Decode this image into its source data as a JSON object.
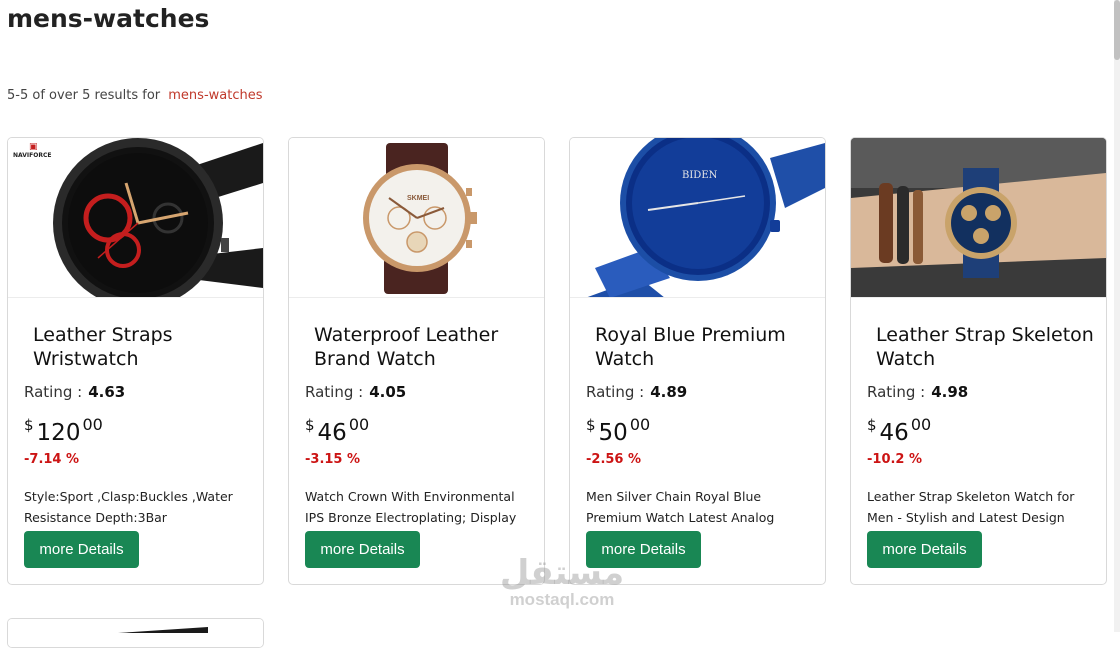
{
  "page": {
    "title": "mens-watches",
    "results_prefix": "5-5 of over 5 results for",
    "results_term": "mens-watches"
  },
  "labels": {
    "rating": "Rating :",
    "currency": "$",
    "more_details": "more Details"
  },
  "products": [
    {
      "name": "Leather Straps Wristwatch",
      "rating": "4.63",
      "price_whole": "120",
      "price_cents": "00",
      "discount": "-7.14 %",
      "description": "Style:Sport ,Clasp:Buckles ,Water Resistance Depth:3Bar",
      "image_brand": "NAVIFORCE"
    },
    {
      "name": "Waterproof Leather Brand Watch",
      "rating": "4.05",
      "price_whole": "46",
      "price_cents": "00",
      "discount": "-3.15 %",
      "description": "Watch Crown With Environmental IPS Bronze Electroplating; Display",
      "image_brand": "SKMEI"
    },
    {
      "name": "Royal Blue Premium Watch",
      "rating": "4.89",
      "price_whole": "50",
      "price_cents": "00",
      "discount": "-2.56 %",
      "description": "Men Silver Chain Royal Blue Premium Watch Latest Analog",
      "image_brand": "BIDEN"
    },
    {
      "name": "Leather Strap Skeleton Watch",
      "rating": "4.98",
      "price_whole": "46",
      "price_cents": "00",
      "discount": "-10.2 %",
      "description": "Leather Strap Skeleton Watch for Men - Stylish and Latest Design",
      "image_brand": ""
    }
  ],
  "watermark": {
    "arabic": "مستقل",
    "latin": "mostaql.com"
  },
  "colors": {
    "button": "#198754",
    "discount": "#cc1414",
    "results_term": "#c0392b"
  }
}
